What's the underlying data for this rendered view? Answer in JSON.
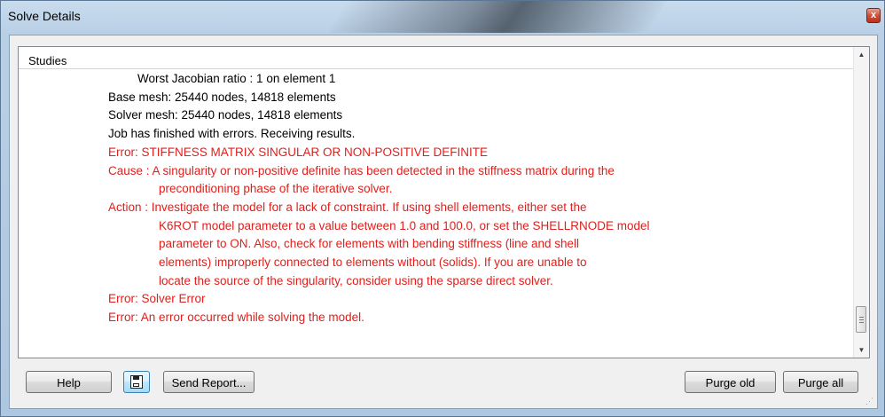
{
  "window": {
    "title": "Solve Details",
    "close_label": "x"
  },
  "list": {
    "header": "Studies",
    "lines": [
      {
        "text": "Worst Jacobian ratio :  1   on element 1",
        "color": "black",
        "indent": 1
      },
      {
        "text": "Base mesh: 25440 nodes, 14818 elements",
        "color": "black",
        "indent": 0
      },
      {
        "text": "Solver mesh: 25440 nodes, 14818 elements",
        "color": "black",
        "indent": 0
      },
      {
        "text": "Job has finished with errors. Receiving results.",
        "color": "black",
        "indent": 0
      },
      {
        "text": "Error: STIFFNESS MATRIX SINGULAR OR NON-POSITIVE DEFINITE",
        "color": "red",
        "indent": 0
      },
      {
        "text": "Cause  : A singularity or non-positive definite has been detected in the stiffness matrix during the",
        "color": "red",
        "indent": 0
      },
      {
        "text": "preconditioning phase of the iterative solver.",
        "color": "red",
        "indent": 2
      },
      {
        "text": "Action : Investigate the model for a lack of constraint. If using shell elements, either set the",
        "color": "red",
        "indent": 0
      },
      {
        "text": "K6ROT model parameter to a value between 1.0 and 100.0, or set the SHELLRNODE model",
        "color": "red",
        "indent": 2
      },
      {
        "text": "parameter to ON. Also, check for elements with bending stiffness (line and shell",
        "color": "red",
        "indent": 2
      },
      {
        "text": "elements) improperly connected to elements without (solids). If you are unable to",
        "color": "red",
        "indent": 2
      },
      {
        "text": "locate the source of the singularity, consider using the sparse direct solver.",
        "color": "red",
        "indent": 2
      },
      {
        "text": "Error: Solver Error",
        "color": "red",
        "indent": 0
      },
      {
        "text": "Error: An error occurred while solving the model.",
        "color": "red",
        "indent": 0
      }
    ]
  },
  "buttons": {
    "help": "Help",
    "send_report": "Send Report...",
    "purge_old": "Purge old",
    "purge_all": "Purge all"
  },
  "icons": {
    "save": "save-disk-icon",
    "close": "close-icon",
    "scroll_up": "arrow-up-icon",
    "scroll_down": "arrow-down-icon"
  },
  "colors": {
    "error_text": "#e0201c",
    "normal_text": "#000000"
  }
}
